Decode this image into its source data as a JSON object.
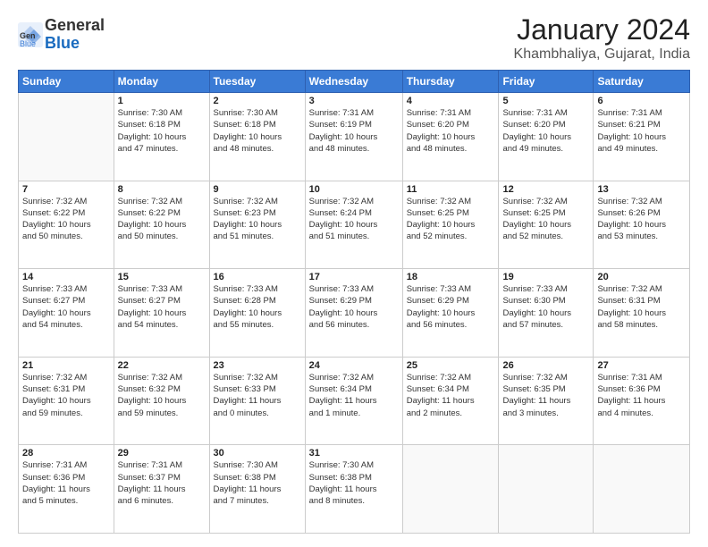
{
  "header": {
    "logo_line1": "General",
    "logo_line2": "Blue",
    "month": "January 2024",
    "location": "Khambhaliya, Gujarat, India"
  },
  "days_of_week": [
    "Sunday",
    "Monday",
    "Tuesday",
    "Wednesday",
    "Thursday",
    "Friday",
    "Saturday"
  ],
  "weeks": [
    [
      {
        "num": "",
        "info": ""
      },
      {
        "num": "1",
        "info": "Sunrise: 7:30 AM\nSunset: 6:18 PM\nDaylight: 10 hours\nand 47 minutes."
      },
      {
        "num": "2",
        "info": "Sunrise: 7:30 AM\nSunset: 6:18 PM\nDaylight: 10 hours\nand 48 minutes."
      },
      {
        "num": "3",
        "info": "Sunrise: 7:31 AM\nSunset: 6:19 PM\nDaylight: 10 hours\nand 48 minutes."
      },
      {
        "num": "4",
        "info": "Sunrise: 7:31 AM\nSunset: 6:20 PM\nDaylight: 10 hours\nand 48 minutes."
      },
      {
        "num": "5",
        "info": "Sunrise: 7:31 AM\nSunset: 6:20 PM\nDaylight: 10 hours\nand 49 minutes."
      },
      {
        "num": "6",
        "info": "Sunrise: 7:31 AM\nSunset: 6:21 PM\nDaylight: 10 hours\nand 49 minutes."
      }
    ],
    [
      {
        "num": "7",
        "info": "Sunrise: 7:32 AM\nSunset: 6:22 PM\nDaylight: 10 hours\nand 50 minutes."
      },
      {
        "num": "8",
        "info": "Sunrise: 7:32 AM\nSunset: 6:22 PM\nDaylight: 10 hours\nand 50 minutes."
      },
      {
        "num": "9",
        "info": "Sunrise: 7:32 AM\nSunset: 6:23 PM\nDaylight: 10 hours\nand 51 minutes."
      },
      {
        "num": "10",
        "info": "Sunrise: 7:32 AM\nSunset: 6:24 PM\nDaylight: 10 hours\nand 51 minutes."
      },
      {
        "num": "11",
        "info": "Sunrise: 7:32 AM\nSunset: 6:25 PM\nDaylight: 10 hours\nand 52 minutes."
      },
      {
        "num": "12",
        "info": "Sunrise: 7:32 AM\nSunset: 6:25 PM\nDaylight: 10 hours\nand 52 minutes."
      },
      {
        "num": "13",
        "info": "Sunrise: 7:32 AM\nSunset: 6:26 PM\nDaylight: 10 hours\nand 53 minutes."
      }
    ],
    [
      {
        "num": "14",
        "info": "Sunrise: 7:33 AM\nSunset: 6:27 PM\nDaylight: 10 hours\nand 54 minutes."
      },
      {
        "num": "15",
        "info": "Sunrise: 7:33 AM\nSunset: 6:27 PM\nDaylight: 10 hours\nand 54 minutes."
      },
      {
        "num": "16",
        "info": "Sunrise: 7:33 AM\nSunset: 6:28 PM\nDaylight: 10 hours\nand 55 minutes."
      },
      {
        "num": "17",
        "info": "Sunrise: 7:33 AM\nSunset: 6:29 PM\nDaylight: 10 hours\nand 56 minutes."
      },
      {
        "num": "18",
        "info": "Sunrise: 7:33 AM\nSunset: 6:29 PM\nDaylight: 10 hours\nand 56 minutes."
      },
      {
        "num": "19",
        "info": "Sunrise: 7:33 AM\nSunset: 6:30 PM\nDaylight: 10 hours\nand 57 minutes."
      },
      {
        "num": "20",
        "info": "Sunrise: 7:32 AM\nSunset: 6:31 PM\nDaylight: 10 hours\nand 58 minutes."
      }
    ],
    [
      {
        "num": "21",
        "info": "Sunrise: 7:32 AM\nSunset: 6:31 PM\nDaylight: 10 hours\nand 59 minutes."
      },
      {
        "num": "22",
        "info": "Sunrise: 7:32 AM\nSunset: 6:32 PM\nDaylight: 10 hours\nand 59 minutes."
      },
      {
        "num": "23",
        "info": "Sunrise: 7:32 AM\nSunset: 6:33 PM\nDaylight: 11 hours\nand 0 minutes."
      },
      {
        "num": "24",
        "info": "Sunrise: 7:32 AM\nSunset: 6:34 PM\nDaylight: 11 hours\nand 1 minute."
      },
      {
        "num": "25",
        "info": "Sunrise: 7:32 AM\nSunset: 6:34 PM\nDaylight: 11 hours\nand 2 minutes."
      },
      {
        "num": "26",
        "info": "Sunrise: 7:32 AM\nSunset: 6:35 PM\nDaylight: 11 hours\nand 3 minutes."
      },
      {
        "num": "27",
        "info": "Sunrise: 7:31 AM\nSunset: 6:36 PM\nDaylight: 11 hours\nand 4 minutes."
      }
    ],
    [
      {
        "num": "28",
        "info": "Sunrise: 7:31 AM\nSunset: 6:36 PM\nDaylight: 11 hours\nand 5 minutes."
      },
      {
        "num": "29",
        "info": "Sunrise: 7:31 AM\nSunset: 6:37 PM\nDaylight: 11 hours\nand 6 minutes."
      },
      {
        "num": "30",
        "info": "Sunrise: 7:30 AM\nSunset: 6:38 PM\nDaylight: 11 hours\nand 7 minutes."
      },
      {
        "num": "31",
        "info": "Sunrise: 7:30 AM\nSunset: 6:38 PM\nDaylight: 11 hours\nand 8 minutes."
      },
      {
        "num": "",
        "info": ""
      },
      {
        "num": "",
        "info": ""
      },
      {
        "num": "",
        "info": ""
      }
    ]
  ]
}
